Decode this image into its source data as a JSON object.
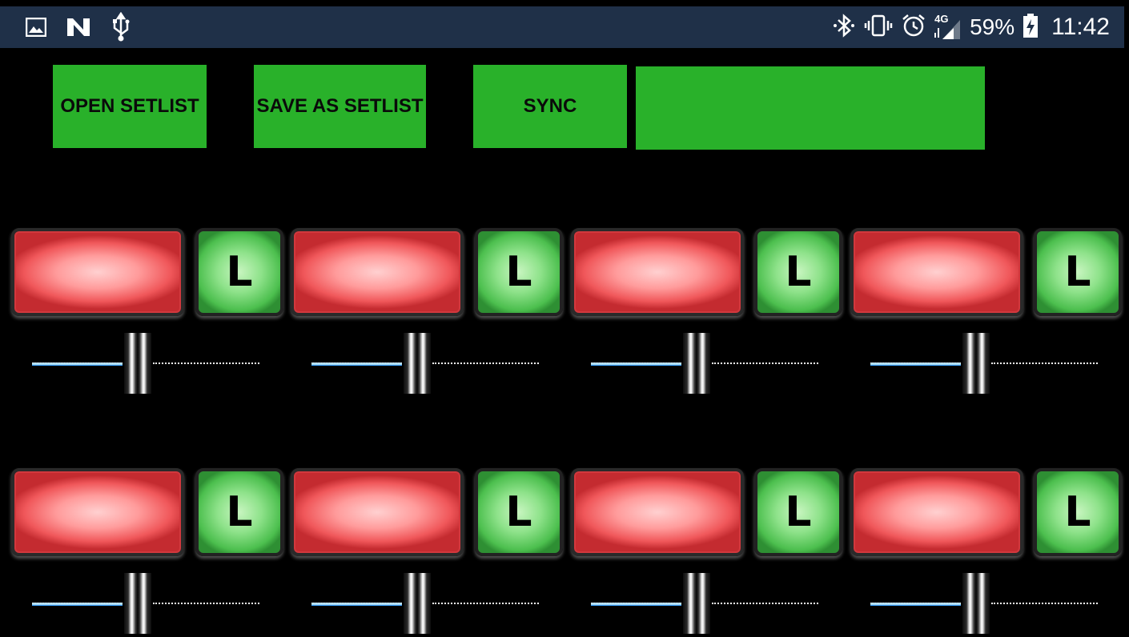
{
  "status_bar": {
    "left_icons": [
      "gallery-icon",
      "nfc-icon",
      "usb-icon"
    ],
    "right_icons": [
      "bluetooth-icon",
      "vibrate-icon",
      "alarm-icon",
      "signal-4g-icon",
      "battery-icon"
    ],
    "network_label": "4G",
    "battery_text": "59%",
    "time": "11:42"
  },
  "toolbar": {
    "open_label": "OPEN SETLIST",
    "save_label": "SAVE AS SETLIST",
    "sync_label": "SYNC",
    "display_text": ""
  },
  "controls": {
    "lock_label": "L",
    "rows": [
      {
        "channels": [
          {
            "slider_level": 0.45
          },
          {
            "slider_level": 0.45
          },
          {
            "slider_level": 0.45
          },
          {
            "slider_level": 0.45
          }
        ]
      },
      {
        "channels": [
          {
            "slider_level": 0.45
          },
          {
            "slider_level": 0.45
          },
          {
            "slider_level": 0.45
          },
          {
            "slider_level": 0.45
          }
        ]
      }
    ]
  },
  "colors": {
    "statusbar_bg": "#1f3048",
    "button_green": "#29b12a",
    "pad_red": "#f0575a",
    "lock_green": "#4cbf4e",
    "slider_blue": "#3aa2ff"
  }
}
